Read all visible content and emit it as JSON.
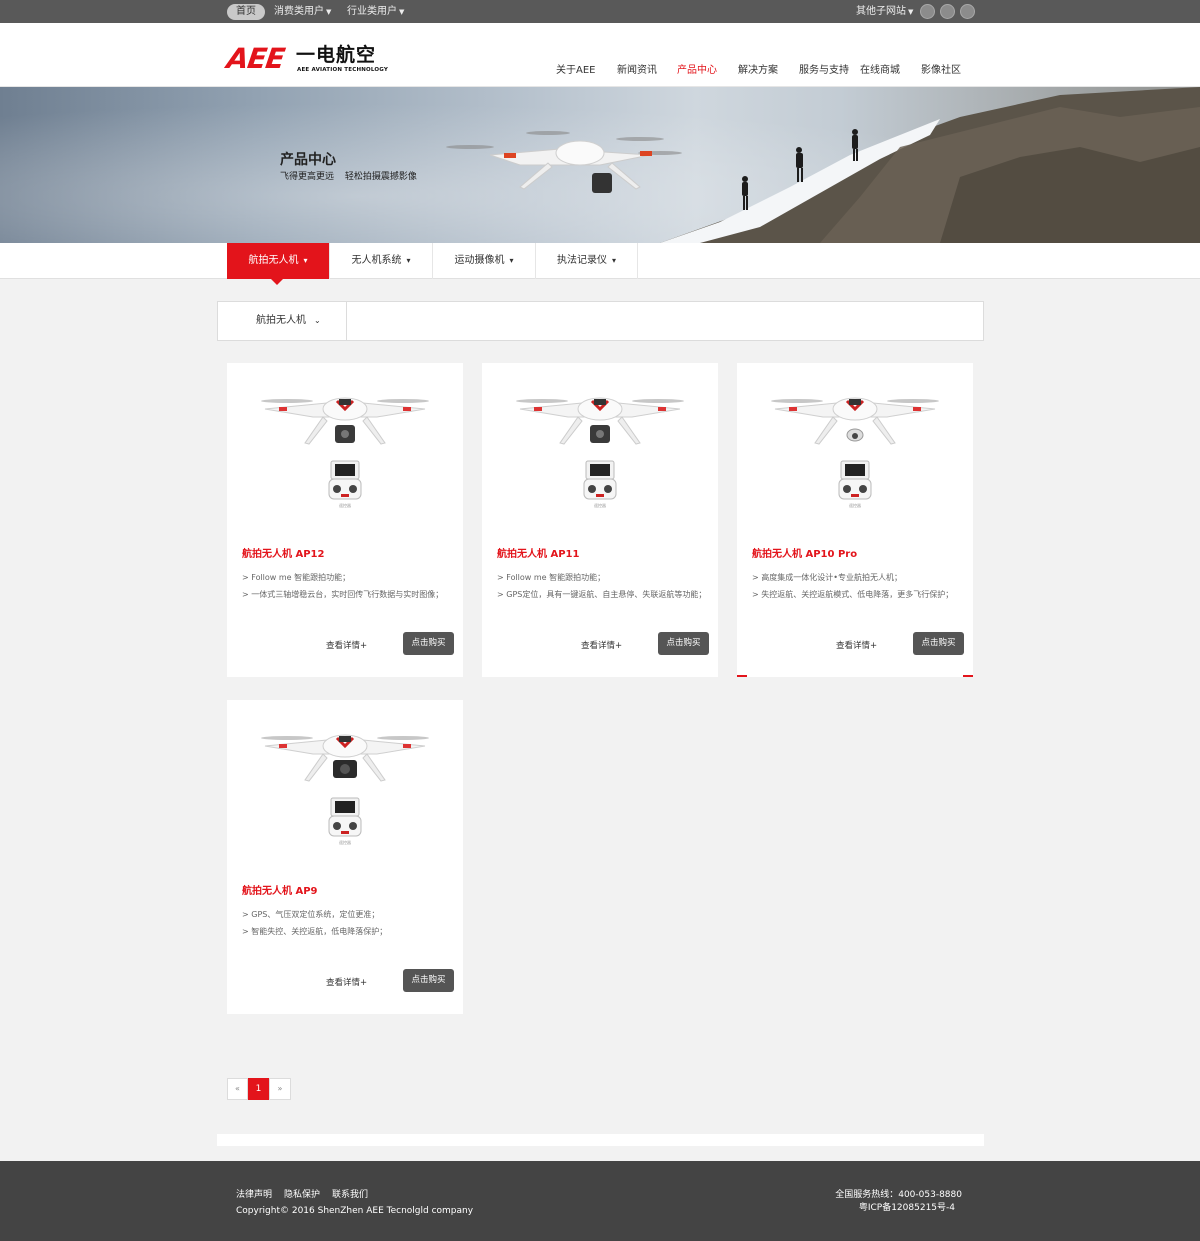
{
  "topbar": {
    "home": "首页",
    "consumer": "消费类用户",
    "industry": "行业类用户",
    "other_sites": "其他子网站",
    "social": [
      "weibo-icon",
      "qq-icon",
      "wechat-icon"
    ]
  },
  "logo": {
    "brand": "AEE",
    "name_cn": "一电航空",
    "name_en": "AEE AVIATION TECHNOLOGY"
  },
  "nav": [
    "关于AEE",
    "新闻资讯",
    "产品中心",
    "解决方案",
    "服务与支持",
    "在线商城",
    "影像社区"
  ],
  "nav_active": "产品中心",
  "banner": {
    "title": "产品中心",
    "subtitle": "飞得更高更远  轻松拍摄震撼影像"
  },
  "tabs": [
    "航拍无人机",
    "无人机系统",
    "运动摄像机",
    "执法记录仪"
  ],
  "filter": {
    "selected": "航拍无人机"
  },
  "products": [
    {
      "name": "航拍无人机 AP12",
      "features": [
        "> Follow me 智能跟拍功能；",
        "> 一体式三轴增稳云台，实时回传飞行数据与实时图像；"
      ],
      "detail": "查看详情+",
      "buy": "点击购买"
    },
    {
      "name": "航拍无人机 AP11",
      "features": [
        "> Follow me 智能跟拍功能；",
        "> GPS定位，具有一键返航、自主悬停、失联返航等功能；"
      ],
      "detail": "查看详情+",
      "buy": "点击购买"
    },
    {
      "name": "航拍无人机 AP10 Pro",
      "features": [
        "> 高度集成一体化设计•专业航拍无人机；",
        "> 失控返航、关控返航模式、低电降落，更多飞行保护；"
      ],
      "detail": "查看详情+",
      "buy": "点击购买"
    },
    {
      "name": "航拍无人机 AP9",
      "features": [
        "> GPS、气压双定位系统，定位更准；",
        "> 智能失控、关控返航，低电降落保护；"
      ],
      "detail": "查看详情+",
      "buy": "点击购买"
    }
  ],
  "remote_label": "遥控器",
  "pagination": {
    "prev": "«",
    "current": "1",
    "next": "»"
  },
  "footer": {
    "links": [
      "法律声明",
      "隐私保护",
      "联系我们"
    ],
    "copyright": "Copyright© 2016 ShenZhen AEE Tecnolgld company",
    "hotline": "全国服务热线：400-053-8880",
    "icp": "粤ICP备12085215号-4"
  },
  "colors": {
    "accent": "#e3141b",
    "topbar": "#595959",
    "footer": "#444444",
    "button": "#555555"
  }
}
